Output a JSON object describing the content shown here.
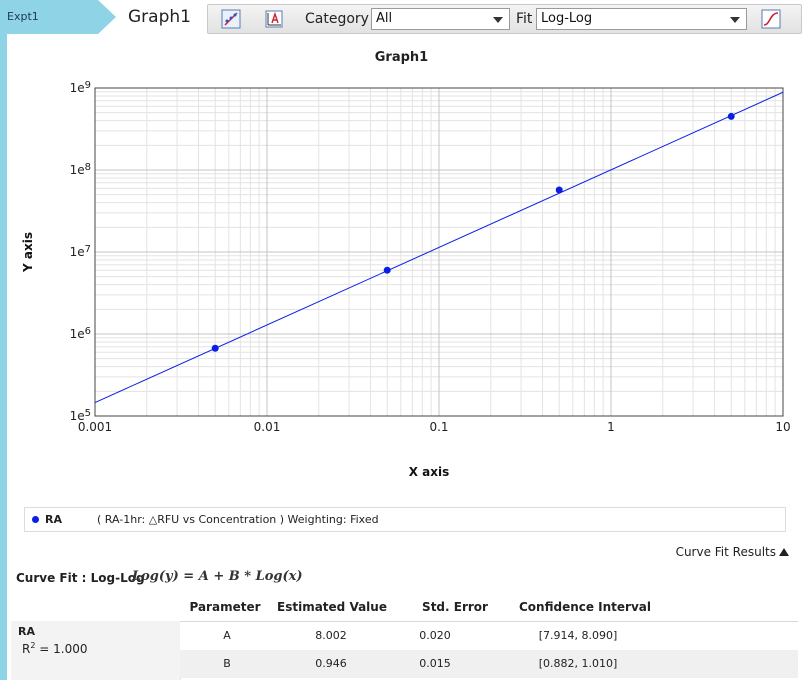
{
  "experiment_tab": {
    "label": "Expt1"
  },
  "graph_name": "Graph1",
  "toolbar": {
    "category_label": "Category",
    "category_value": "All",
    "fit_label": "Fit",
    "fit_value": "Log-Log"
  },
  "chart_data": {
    "type": "scatter",
    "title": "Graph1",
    "xlabel": "X axis",
    "ylabel": "Y axis",
    "x_scale": "log",
    "y_scale": "log",
    "xlim": [
      0.001,
      10
    ],
    "ylim": [
      100000,
      1000000000
    ],
    "x_ticks": [
      "0.001",
      "0.01",
      "0.1",
      "1",
      "10"
    ],
    "y_ticks": [
      "1e5",
      "1e6",
      "1e7",
      "1e8",
      "1e9"
    ],
    "grid": true,
    "series": [
      {
        "name": "RA",
        "color": "#0b1ee6",
        "points": [
          {
            "x": 0.005,
            "y": 670000
          },
          {
            "x": 0.05,
            "y": 6000000
          },
          {
            "x": 0.5,
            "y": 57000000
          },
          {
            "x": 5,
            "y": 450000000
          }
        ],
        "fit": {
          "model": "Log-Log",
          "A": 8.002,
          "B": 0.946
        }
      }
    ]
  },
  "legend": {
    "name": "RA",
    "description": "( RA-1hr: △RFU vs Concentration )  Weighting: Fixed",
    "color": "#0b1ee6"
  },
  "results": {
    "toggle_label": "Curve Fit Results",
    "fit_title": "Curve Fit : Log-Log",
    "formula": "Log(y) = A + B * Log(x)",
    "headers": [
      "Parameter",
      "Estimated Value",
      "Std. Error",
      "Confidence Interval"
    ],
    "series_name": "RA",
    "r2_label": "R",
    "r2_sup": "2",
    "r2_value": " = 1.000",
    "rows": [
      [
        "A",
        "8.002",
        "0.020",
        "[7.914, 8.090]"
      ],
      [
        "B",
        "0.946",
        "0.015",
        "[0.882, 1.010]"
      ]
    ]
  }
}
